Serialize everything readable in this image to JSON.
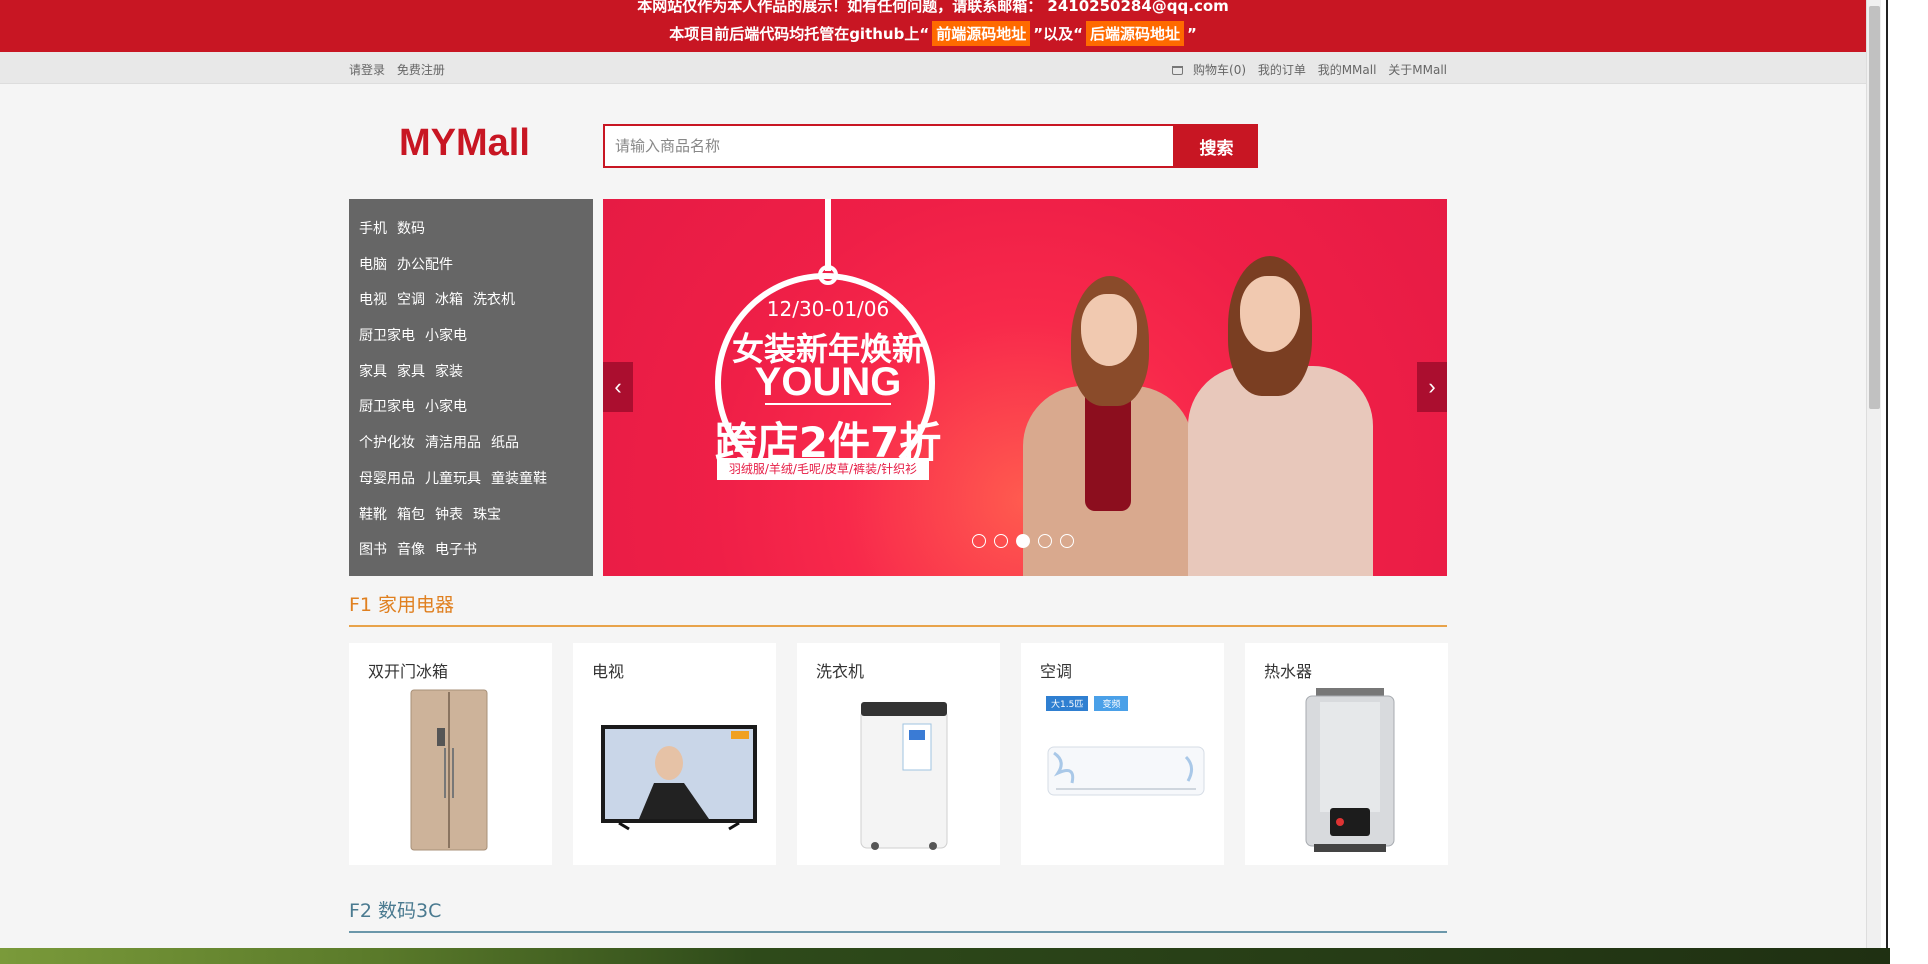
{
  "notice": {
    "line1": "本网站仅作为本人作品的展示！如有任何问题，请联系邮箱： 2410250284@qq.com",
    "line2_prefix": "本项目前后端代码均托管在github上“",
    "frontend_link": "前端源码地址",
    "line2_middle": "”以及“",
    "backend_link": "后端源码地址",
    "line2_suffix": "”"
  },
  "topbar": {
    "login": "请登录",
    "register": "免费注册",
    "cart": "购物车(0)",
    "orders": "我的订单",
    "my_mall": "我的MMall",
    "about": "关于MMall"
  },
  "header": {
    "logo": "MYMall",
    "search_placeholder": "请输入商品名称",
    "search_button": "搜索"
  },
  "categories": [
    [
      "手机",
      "数码"
    ],
    [
      "电脑",
      "办公配件"
    ],
    [
      "电视",
      "空调",
      "冰箱",
      "洗衣机"
    ],
    [
      "厨卫家电",
      "小家电"
    ],
    [
      "家具",
      "家具",
      "家装"
    ],
    [
      "厨卫家电",
      "小家电"
    ],
    [
      "个护化妆",
      "清洁用品",
      "纸品"
    ],
    [
      "母婴用品",
      "儿童玩具",
      "童装童鞋"
    ],
    [
      "鞋靴",
      "箱包",
      "钟表",
      "珠宝"
    ],
    [
      "图书",
      "音像",
      "电子书"
    ]
  ],
  "banner": {
    "date": "12/30-01/06",
    "title": "女装新年焕新",
    "young": "YOUNG",
    "sale": "跨店2件7折",
    "tags": "羽绒服/羊绒/毛呢/皮草/裤装/针织衫",
    "active_slide": 3,
    "slide_count": 5
  },
  "floors": [
    {
      "title": "F1 家用电器",
      "products": [
        {
          "name": "双开门冰箱",
          "icon": "fridge-icon"
        },
        {
          "name": "电视",
          "icon": "tv-icon"
        },
        {
          "name": "洗衣机",
          "icon": "washer-icon"
        },
        {
          "name": "空调",
          "icon": "ac-icon"
        },
        {
          "name": "热水器",
          "icon": "water-heater-icon"
        }
      ]
    },
    {
      "title": "F2 数码3C"
    }
  ],
  "ac_badges": [
    "大1.5匹",
    "变频"
  ],
  "colors": {
    "brand_red": "#c81623",
    "notice_tag": "#ff6a00",
    "category_bg": "#666666",
    "f1_accent": "#e08020",
    "f2_accent": "#4a7a90"
  }
}
